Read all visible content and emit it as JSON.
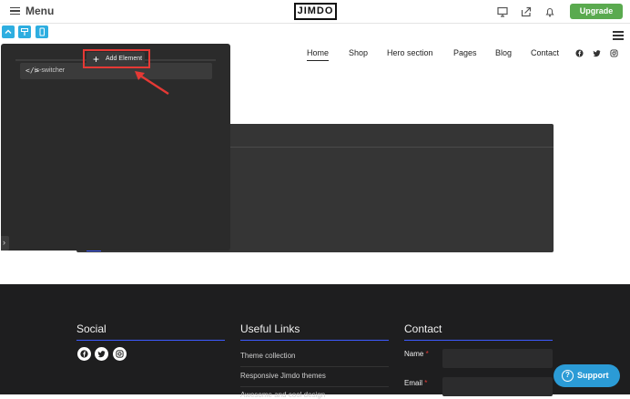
{
  "topbar": {
    "menu_label": "Menu",
    "logo_text": "JIMDO",
    "upgrade_label": "Upgrade",
    "icons": [
      "desktop-preview-icon",
      "share-icon",
      "bell-icon"
    ]
  },
  "view_toggles": [
    "collapse-icon",
    "paint-icon",
    "mobile-icon"
  ],
  "nav": {
    "items": [
      "Home",
      "Shop",
      "Hero section",
      "Pages",
      "Blog",
      "Contact"
    ],
    "active": "Home",
    "social_icons": [
      "facebook-icon",
      "twitter-icon",
      "instagram-icon"
    ]
  },
  "panel": {
    "add_element_label": "Add Element",
    "item_code": "</>",
    "item_label": "is-switcher"
  },
  "footer": {
    "social_heading": "Social",
    "links_heading": "Useful Links",
    "contact_heading": "Contact",
    "links": [
      "Theme collection",
      "Responsive Jimdo themes",
      "Awesome and cool design"
    ],
    "name_label": "Name",
    "email_label": "Email",
    "required_mark": "*"
  },
  "support": {
    "label": "Support",
    "icon_text": "?"
  },
  "colors": {
    "upgrade": "#5aaa4f",
    "accent_blue": "#2eaee0",
    "highlight_red": "#e53935",
    "footer_bg": "#1e1e1f",
    "rule_blue": "#3d5afe"
  }
}
